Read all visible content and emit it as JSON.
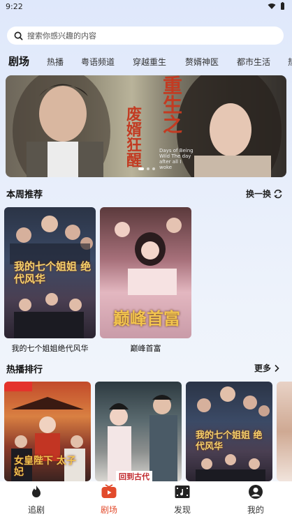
{
  "status": {
    "time": "9:22"
  },
  "search": {
    "placeholder": "搜索你感兴趣的内容"
  },
  "tabs": [
    "剧场",
    "热播",
    "粤语频道",
    "穿越重生",
    "赘婿神医",
    "都市生活",
    "热"
  ],
  "banner": {
    "title_big": "重生之",
    "title_side": "废婿狂醒",
    "subtitle_en": "Days of Being Wild The day after all I woke"
  },
  "weekly": {
    "title": "本周推荐",
    "refresh_label": "换一换",
    "items": [
      {
        "title": "我的七个姐姐绝代风华",
        "poster_text": "我的七个姐姐 绝代风华"
      },
      {
        "title": "巅峰首富",
        "poster_text": "巅峰首富"
      }
    ]
  },
  "hot": {
    "title": "热播排行",
    "more_label": "更多",
    "posters": [
      {
        "poster_text": "女皇陛下 太子妃"
      },
      {
        "poster_text": "回到古代"
      },
      {
        "poster_text": "我的七个姐姐 绝代风华"
      }
    ]
  },
  "nav": [
    {
      "label": "追剧",
      "icon": "fire-icon"
    },
    {
      "label": "剧场",
      "icon": "tv-icon"
    },
    {
      "label": "发现",
      "icon": "film-icon"
    },
    {
      "label": "我的",
      "icon": "user-icon"
    }
  ],
  "colors": {
    "accent": "#e24a2b",
    "banner_title": "#c23b22"
  }
}
